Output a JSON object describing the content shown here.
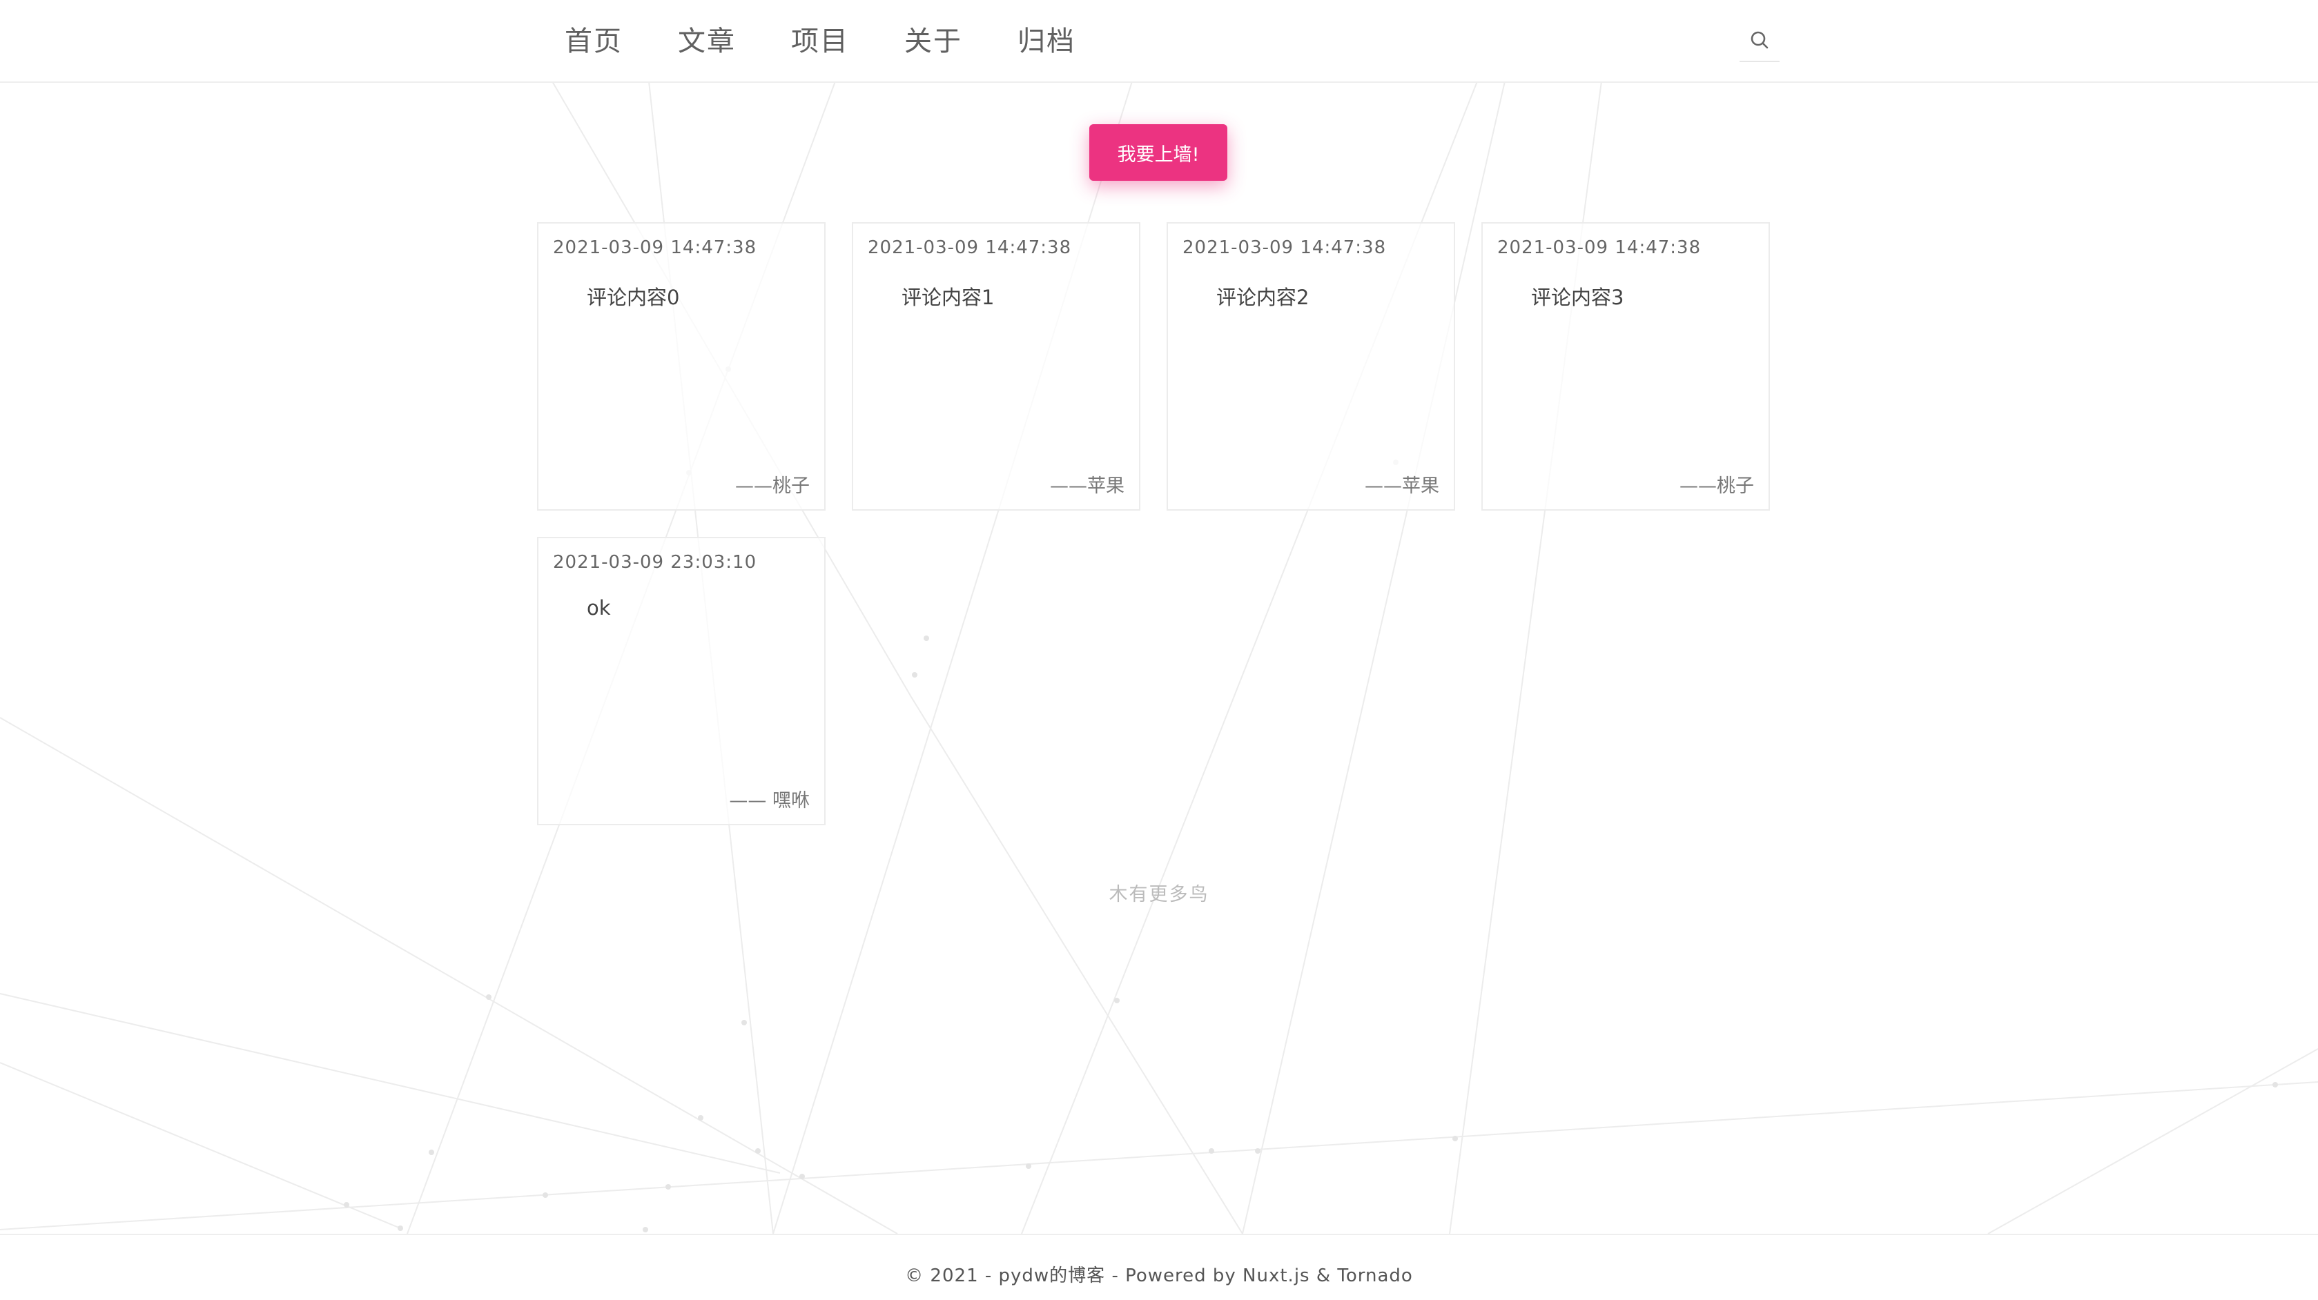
{
  "nav": {
    "items": [
      "首页",
      "文章",
      "项目",
      "关于",
      "归档"
    ],
    "search_icon": "search-icon"
  },
  "main": {
    "wall_button_label": "我要上墙!",
    "cards": [
      {
        "time": "2021-03-09 14:47:38",
        "content": "评论内容0",
        "author": "——桃子"
      },
      {
        "time": "2021-03-09 14:47:38",
        "content": "评论内容1",
        "author": "——苹果"
      },
      {
        "time": "2021-03-09 14:47:38",
        "content": "评论内容2",
        "author": "——苹果"
      },
      {
        "time": "2021-03-09 14:47:38",
        "content": "评论内容3",
        "author": "——桃子"
      },
      {
        "time": "2021-03-09 23:03:10",
        "content": "ok",
        "author": "—— 嘿咻"
      }
    ],
    "no_more_text": "木有更多鸟"
  },
  "footer": {
    "text": "© 2021 - pydw的博客 - Powered by Nuxt.js & Tornado"
  },
  "colors": {
    "accent": "#ec3381",
    "border": "#ececec",
    "background": "#ffffff"
  }
}
